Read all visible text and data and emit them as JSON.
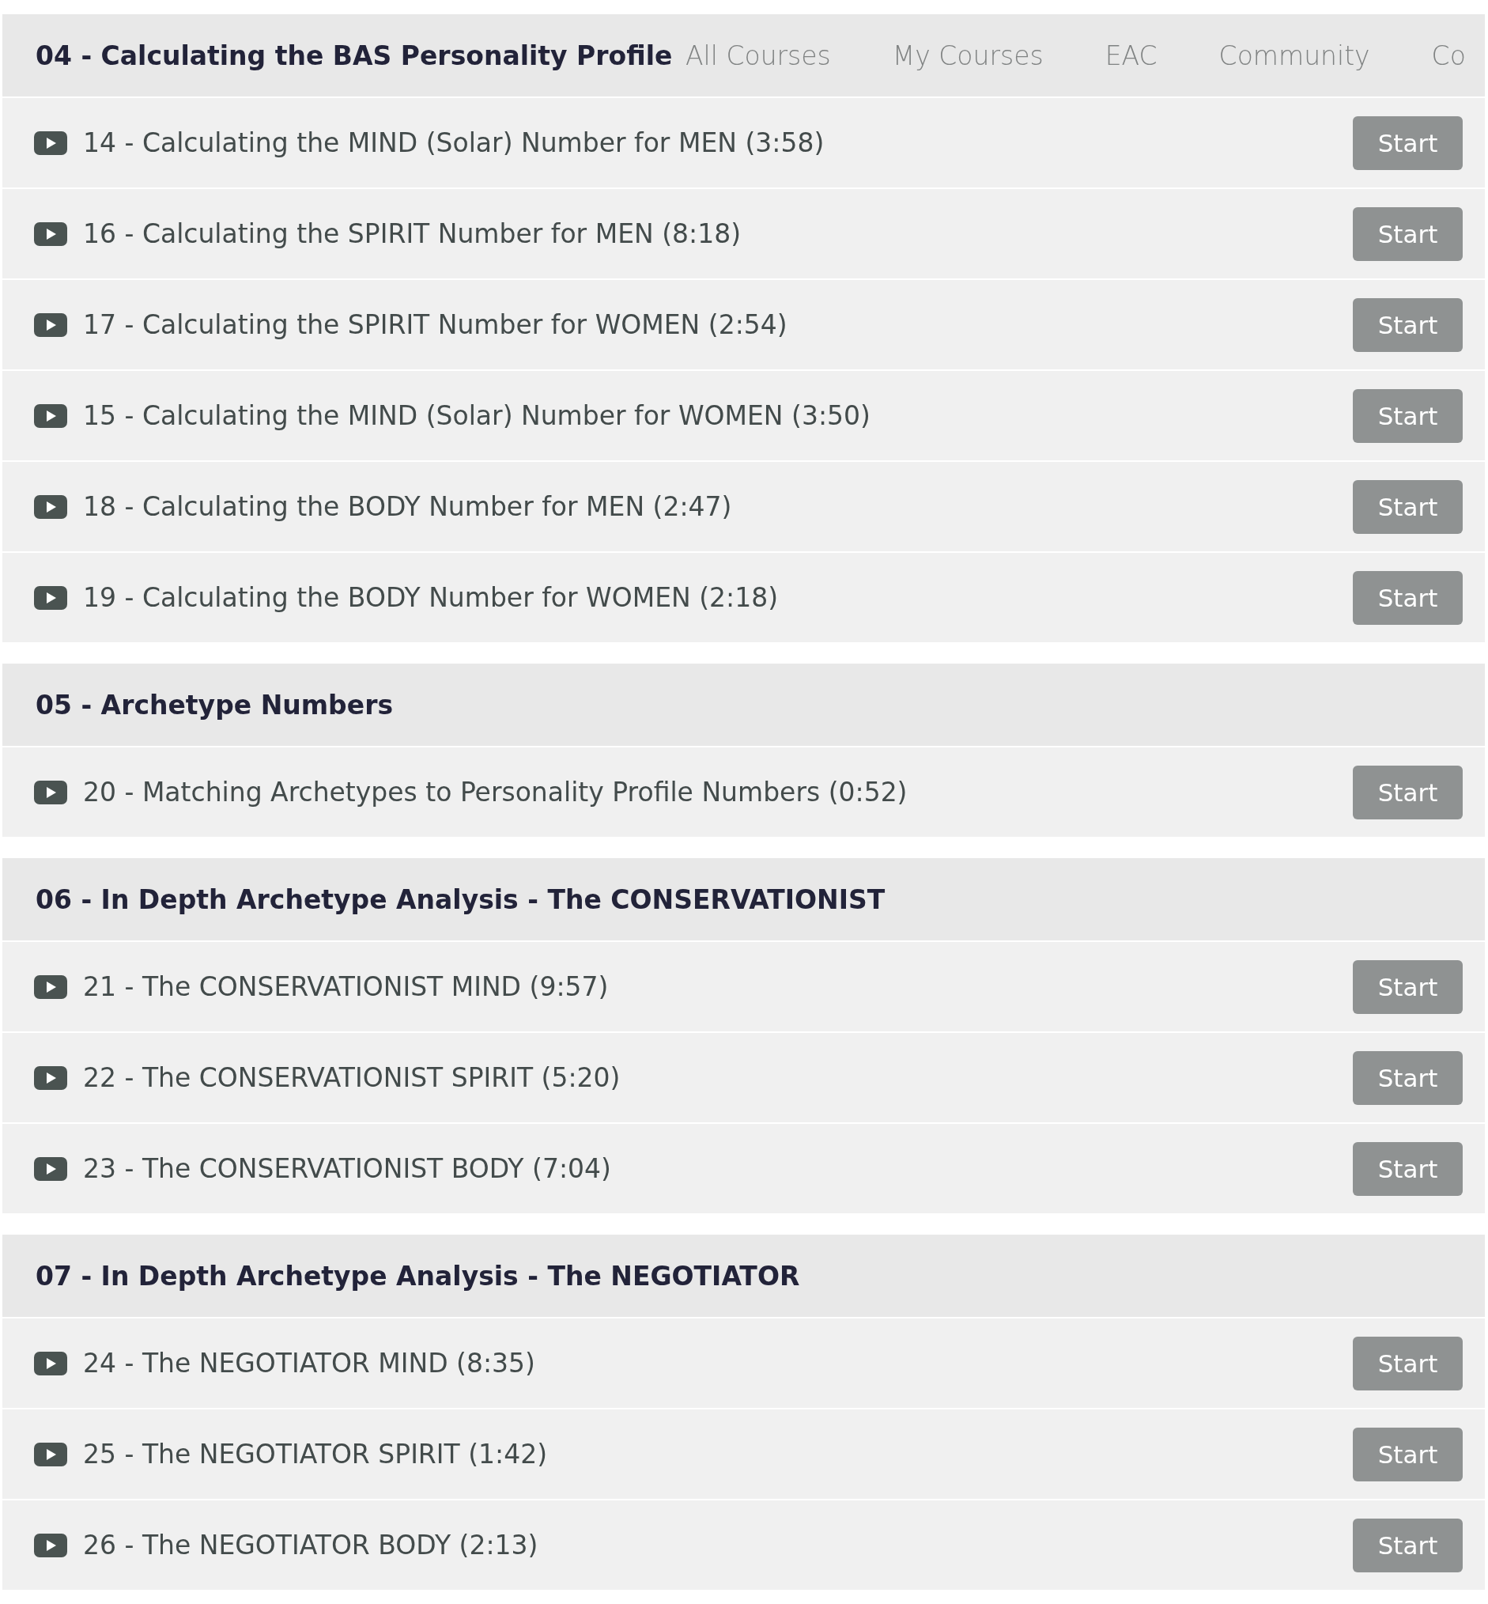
{
  "nav": [
    "All Courses",
    "My Courses",
    "EAC",
    "Community",
    "Co"
  ],
  "sections": [
    {
      "title": "04 - Calculating the BAS Personality Profile",
      "lessons": [
        {
          "title": "14 - Calculating the MIND (Solar) Number for MEN (3:58)",
          "button": "Start"
        },
        {
          "title": "16 - Calculating the SPIRIT Number for MEN (8:18)",
          "button": "Start"
        },
        {
          "title": "17 - Calculating the SPIRIT Number for WOMEN (2:54)",
          "button": "Start"
        },
        {
          "title": "15 - Calculating the MIND (Solar) Number for WOMEN (3:50)",
          "button": "Start"
        },
        {
          "title": "18 - Calculating the BODY Number for MEN (2:47)",
          "button": "Start"
        },
        {
          "title": "19 - Calculating the BODY Number for WOMEN (2:18)",
          "button": "Start"
        }
      ]
    },
    {
      "title": "05 - Archetype Numbers",
      "lessons": [
        {
          "title": "20 - Matching Archetypes to Personality Profile Numbers (0:52)",
          "button": "Start"
        }
      ]
    },
    {
      "title": "06 - In Depth Archetype Analysis - The CONSERVATIONIST",
      "lessons": [
        {
          "title": "21 - The CONSERVATIONIST MIND (9:57)",
          "button": "Start"
        },
        {
          "title": "22 - The CONSERVATIONIST SPIRIT (5:20)",
          "button": "Start"
        },
        {
          "title": "23 - The CONSERVATIONIST BODY (7:04)",
          "button": "Start"
        }
      ]
    },
    {
      "title": "07 - In Depth Archetype Analysis - The NEGOTIATOR",
      "lessons": [
        {
          "title": "24 - The NEGOTIATOR MIND (8:35)",
          "button": "Start"
        },
        {
          "title": "25 - The NEGOTIATOR SPIRIT (1:42)",
          "button": "Start"
        },
        {
          "title": "26 - The NEGOTIATOR BODY (2:13)",
          "button": "Start"
        }
      ]
    }
  ]
}
